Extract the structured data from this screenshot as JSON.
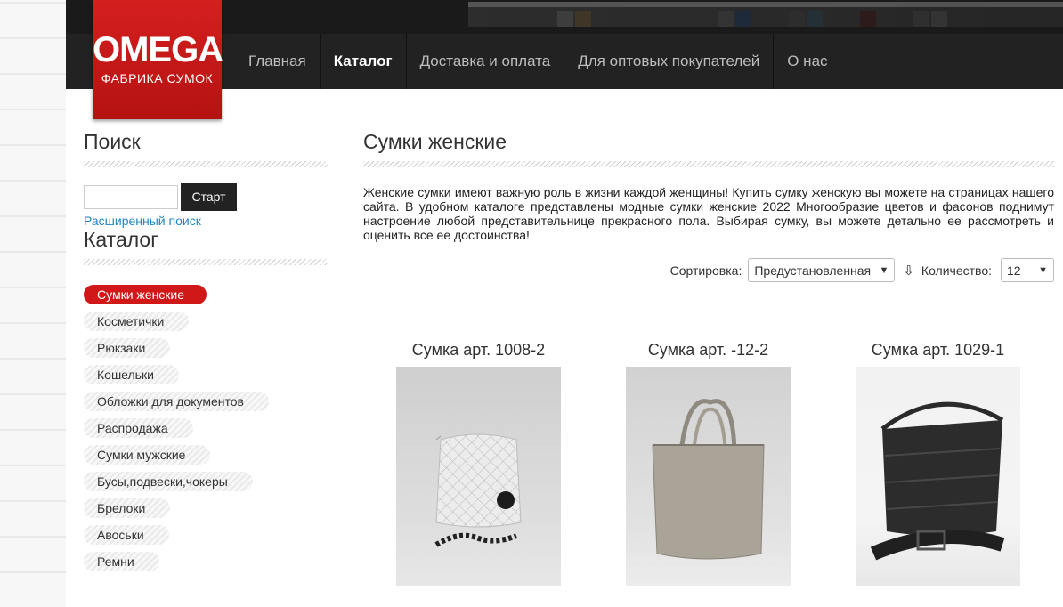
{
  "brand": {
    "name": "OMEGA",
    "tagline": "ФАБРИКА СУМОК",
    "color": "#c81616"
  },
  "nav": {
    "items": [
      {
        "label": "Главная",
        "active": false
      },
      {
        "label": "Каталог",
        "active": true
      },
      {
        "label": "Доставка и оплата",
        "active": false
      },
      {
        "label": "Для оптовых покупателей",
        "active": false
      },
      {
        "label": "О нас",
        "active": false
      }
    ]
  },
  "sidebar": {
    "search_title": "Поиск",
    "search_button": "Старт",
    "search_value": "",
    "advanced_link": "Расширенный поиск",
    "catalog_title": "Каталог",
    "categories": [
      {
        "label": "Сумки женские",
        "active": true
      },
      {
        "label": "Косметички",
        "active": false
      },
      {
        "label": "Рюкзаки",
        "active": false
      },
      {
        "label": "Кошельки",
        "active": false
      },
      {
        "label": "Обложки для документов",
        "active": false
      },
      {
        "label": "Распродажа",
        "active": false
      },
      {
        "label": "Сумки мужские",
        "active": false
      },
      {
        "label": "Бусы,подвески,чокеры",
        "active": false
      },
      {
        "label": "Брелоки",
        "active": false
      },
      {
        "label": "Авоськи",
        "active": false
      },
      {
        "label": "Ремни",
        "active": false
      }
    ]
  },
  "main": {
    "title": "Сумки женские",
    "description": "Женские сумки  имеют  важную  роль в жизни каждой женщины! Купить сумку женскую вы можете на страницах нашего сайта. В удобном каталоге представлены модные сумки женские 2022 Многообразие цветов и фасонов поднимут настроение  любой представительнице прекрасного пола. Выбирая сумку, вы можете детально ее рассмотреть и оценить все ее достоинства!",
    "sort_label": "Сортировка:",
    "sort_value": "Предустановленная",
    "count_label": "Количество:",
    "count_value": "12"
  },
  "products": [
    {
      "name": "Сумка арт. 1008-2",
      "image_icon": "white-quilted-bag"
    },
    {
      "name": "Сумка арт. -12-2",
      "image_icon": "beige-tote-bag"
    },
    {
      "name": "Сумка арт. 1029-1",
      "image_icon": "black-puffer-bag"
    }
  ]
}
